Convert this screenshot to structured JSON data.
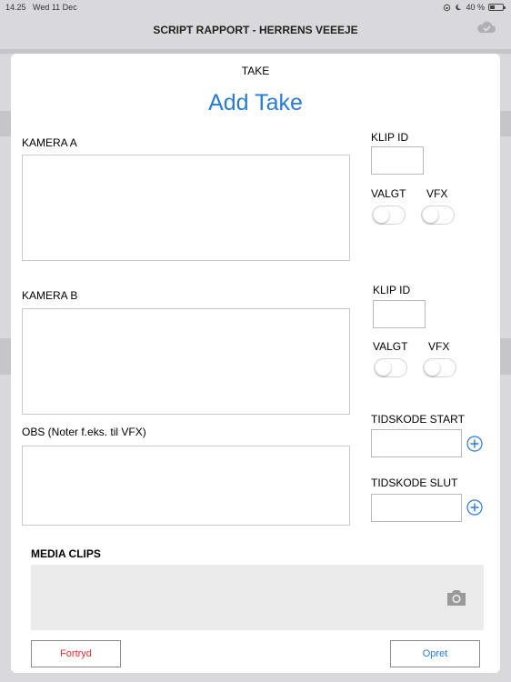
{
  "status_bar": {
    "time": "14.25",
    "date": "Wed 11 Dec",
    "battery": "40 %",
    "battery_level": 0.4
  },
  "background_app": {
    "title": "SCRIPT RAPPORT - HERRENS VEEEJE"
  },
  "sheet": {
    "caption": "TAKE",
    "title": "Add Take",
    "camera_a": {
      "label": "KAMERA A",
      "clip_id_label": "KLIP ID",
      "valgt_label": "VALGT",
      "vfx_label": "VFX",
      "valgt_on": false,
      "vfx_on": false
    },
    "camera_b": {
      "label": "KAMERA B",
      "clip_id_label": "KLIP ID",
      "valgt_label": "VALGT",
      "vfx_label": "VFX",
      "valgt_on": false,
      "vfx_on": false
    },
    "obs_label": "OBS (Noter f.eks. til VFX)",
    "timecode_start_label": "TIDSKODE START",
    "timecode_end_label": "TIDSKODE SLUT",
    "media_clips_label": "MEDIA CLIPS",
    "cancel_label": "Fortryd",
    "create_label": "Opret"
  },
  "colors": {
    "accent": "#2a7bd6",
    "destructive": "#e0332f"
  },
  "icons": [
    "cloud-icon",
    "moon-icon",
    "plus-circle-icon",
    "camera-icon"
  ]
}
